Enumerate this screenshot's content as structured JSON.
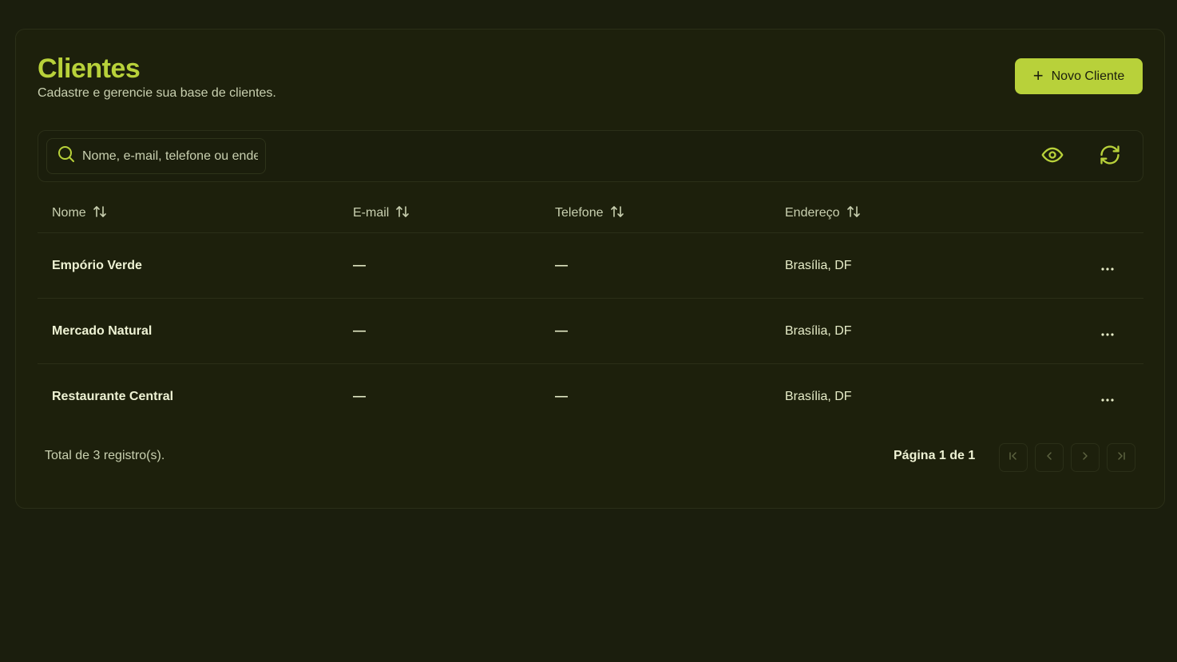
{
  "header": {
    "title": "Clientes",
    "subtitle": "Cadastre e gerencie sua base de clientes.",
    "new_button_label": "Novo Cliente"
  },
  "search": {
    "placeholder": "Nome, e-mail, telefone ou endereço",
    "value": ""
  },
  "table": {
    "columns": [
      "Nome",
      "E-mail",
      "Telefone",
      "Endereço"
    ],
    "rows": [
      {
        "name": "Empório Verde",
        "email": "—",
        "phone": "—",
        "address": "Brasília, DF"
      },
      {
        "name": "Mercado Natural",
        "email": "—",
        "phone": "—",
        "address": "Brasília, DF"
      },
      {
        "name": "Restaurante Central",
        "email": "—",
        "phone": "—",
        "address": "Brasília, DF"
      }
    ]
  },
  "footer": {
    "total_text": "Total de 3 registro(s).",
    "page_text": "Página 1 de 1"
  },
  "colors": {
    "accent": "#b8d13a",
    "background": "#1b1e0d",
    "text": "#e6ecc8"
  },
  "icons": {
    "new": "plus-icon",
    "search": "search-icon",
    "visibility": "eye-icon",
    "refresh": "refresh-icon",
    "sort": "sort-icon",
    "row_actions": "more-horizontal-icon",
    "pagination": [
      "first-page-icon",
      "prev-page-icon",
      "next-page-icon",
      "last-page-icon"
    ]
  }
}
